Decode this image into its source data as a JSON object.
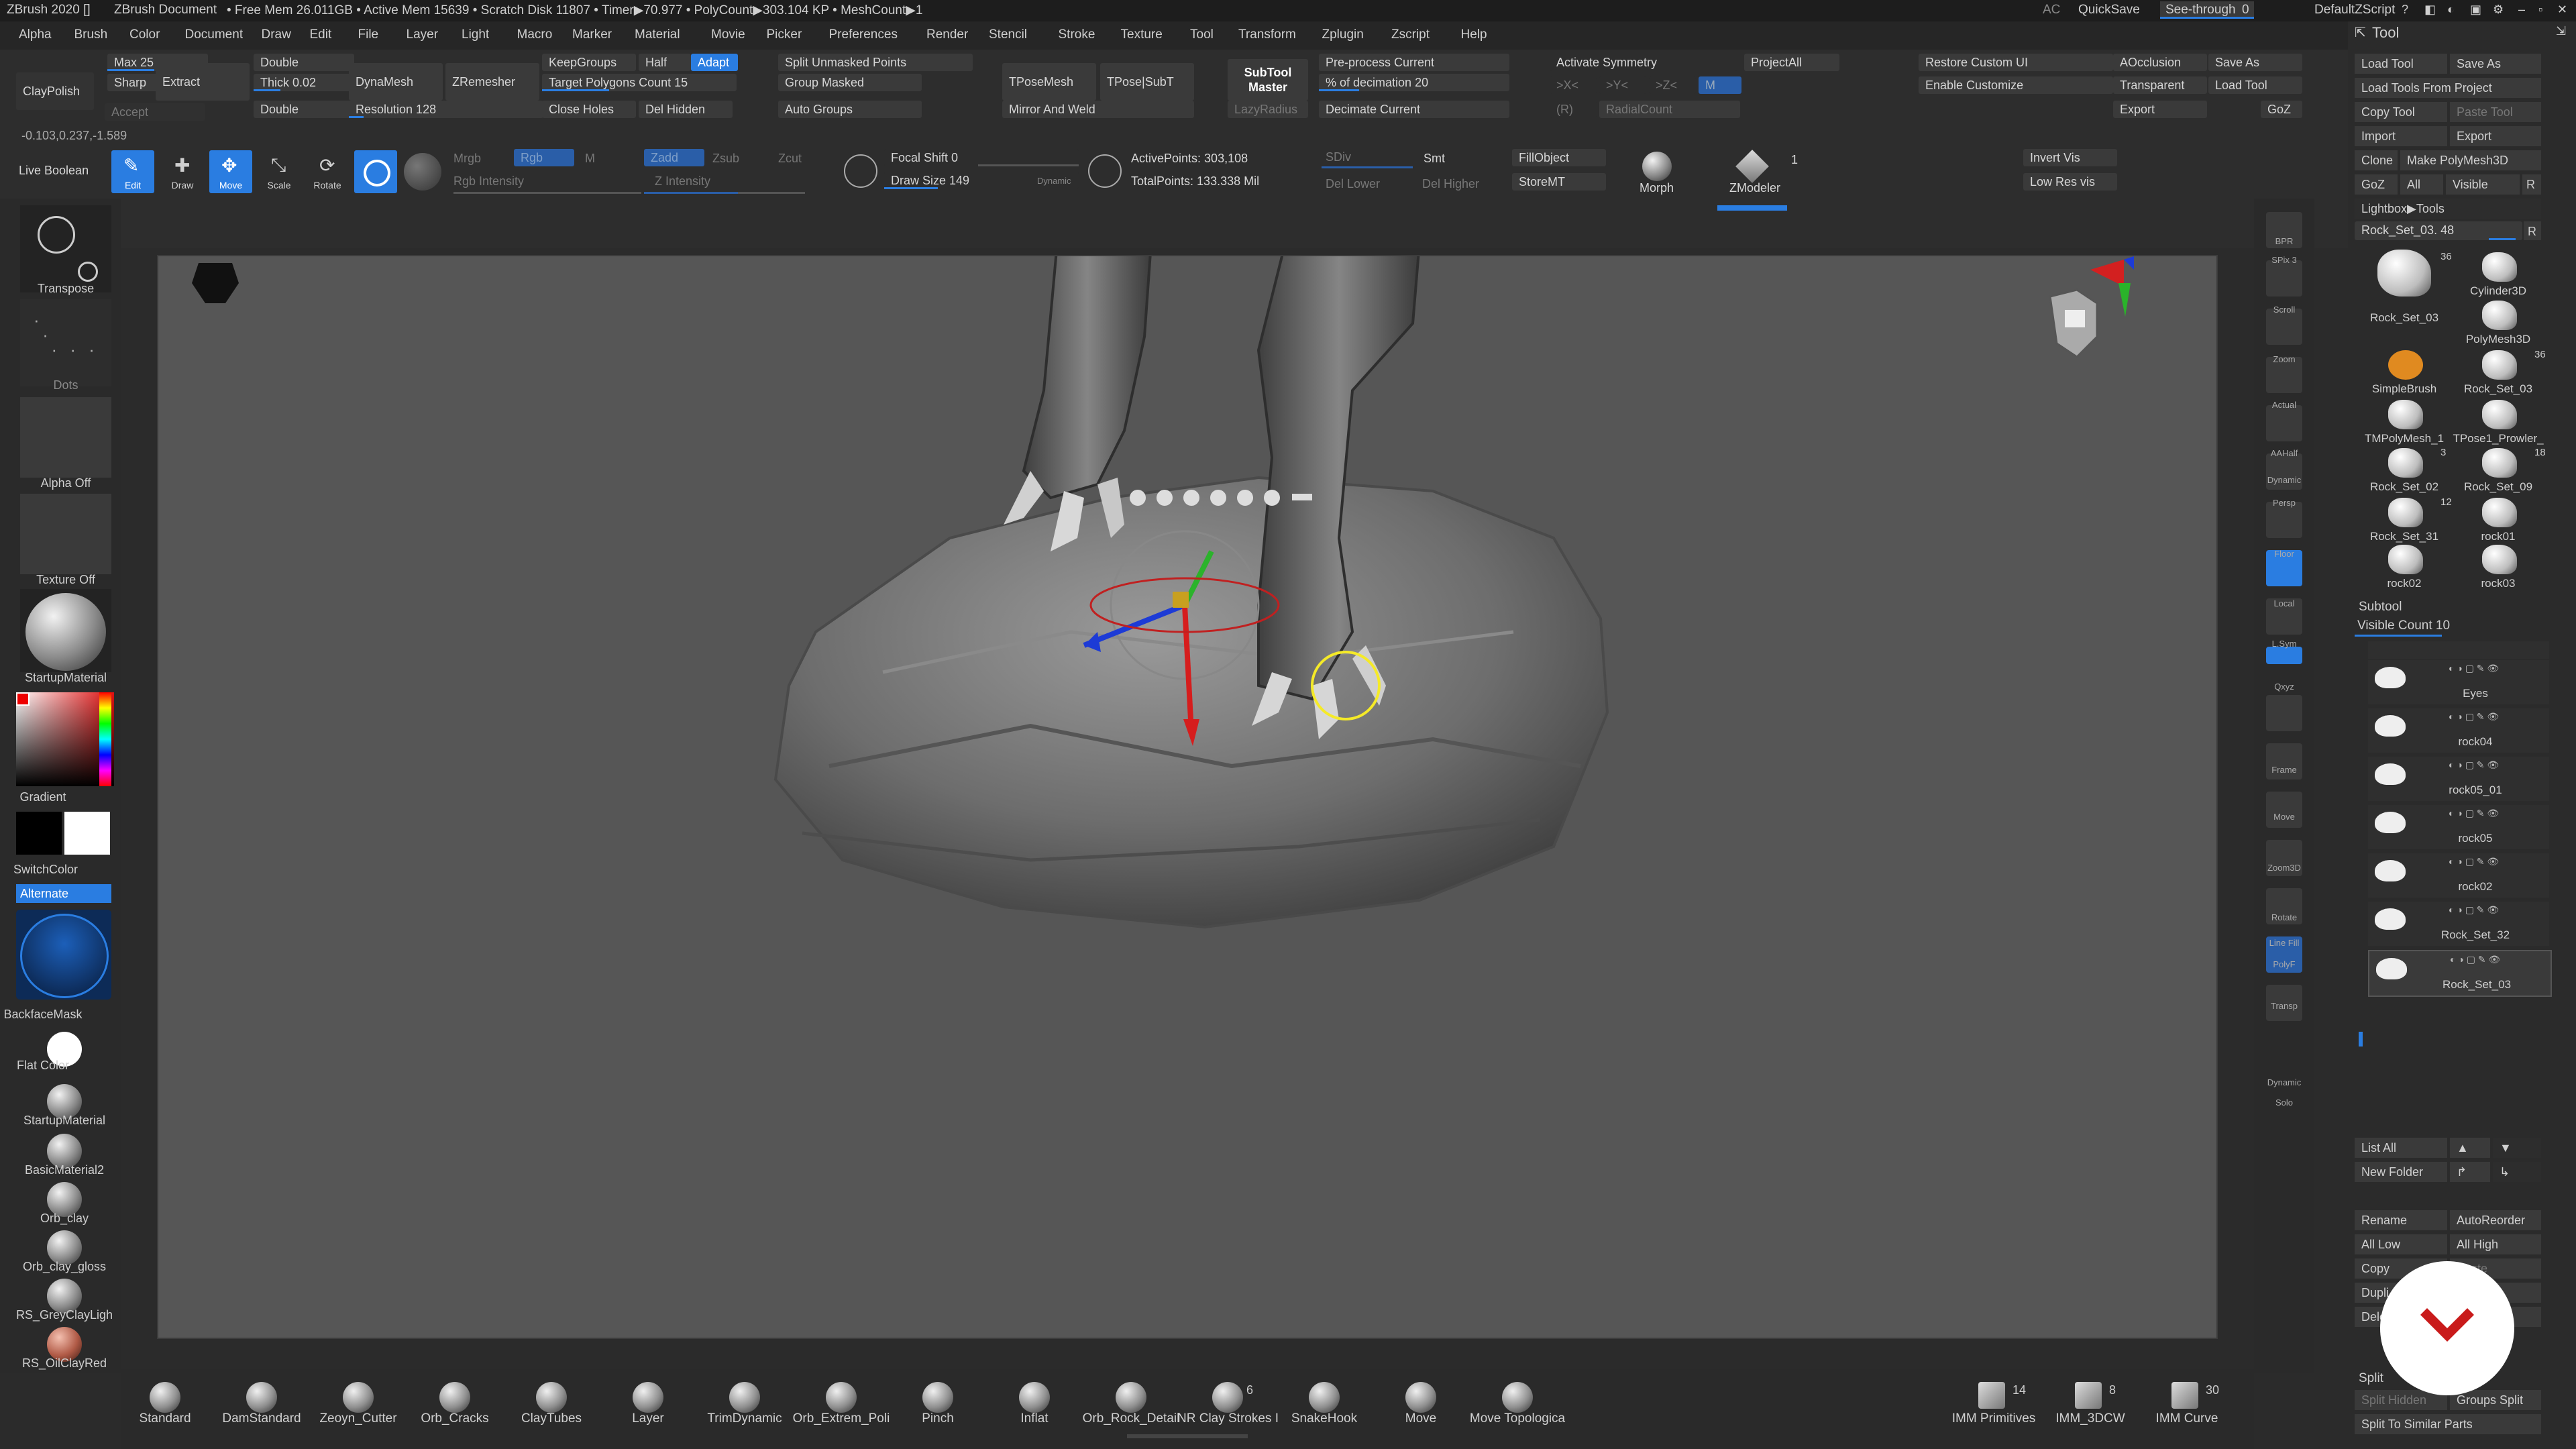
{
  "title": {
    "app": "ZBrush 2020 []",
    "doc": "ZBrush Document",
    "stats": "• Free Mem 26.011GB • Active Mem 15639 • Scratch Disk 11807 • Timer▶70.977 • PolyCount▶303.104 KP • MeshCount▶1",
    "ac": "AC",
    "quicksave": "QuickSave",
    "see_through": "See-through",
    "see_through_val": "0",
    "script": "DefaultZScript"
  },
  "menu": [
    "Alpha",
    "Brush",
    "Color",
    "Document",
    "Draw",
    "Edit",
    "File",
    "Layer",
    "Light",
    "Macro",
    "Marker",
    "Material",
    "Movie",
    "Picker",
    "Preferences",
    "Render",
    "Stencil",
    "Stroke",
    "Texture",
    "Tool",
    "Transform",
    "Zplugin",
    "Zscript",
    "Help"
  ],
  "toolbar": {
    "claypolish": "ClayPolish",
    "accept": "Accept",
    "max": "Max 25",
    "sharp": "Sharp",
    "extract": "Extract",
    "double1": "Double",
    "thick": "Thick 0.02",
    "double2": "Double",
    "dynamesh": "DynaMesh",
    "resolution": "Resolution 128",
    "zremesher": "ZRemesher",
    "keepgroups": "KeepGroups",
    "half": "Half",
    "adapt": "Adapt",
    "target_polygons": "Target Polygons Count 15",
    "close_holes": "Close Holes",
    "del_hidden": "Del Hidden",
    "split_unmasked": "Split Unmasked Points",
    "group_masked": "Group Masked",
    "auto_groups": "Auto Groups",
    "tposemesh": "TPoseMesh",
    "tpose_subt": "TPose|SubT",
    "mirror_weld": "Mirror And Weld",
    "subtool_master_1": "SubTool",
    "subtool_master_2": "Master",
    "lazyradius": "LazyRadius",
    "preprocess": "Pre-process Current",
    "decimation": "% of decimation 20",
    "decimate_current": "Decimate Current",
    "activate_symmetry": "Activate Symmetry",
    "sym_x": ">X<",
    "sym_y": ">Y<",
    "sym_z": ">Z<",
    "sym_m": "M",
    "sym_r": "(R)",
    "radialcount": "RadialCount",
    "projectall": "ProjectAll",
    "restore_ui": "Restore Custom UI",
    "enable_customize": "Enable Customize",
    "aocclusion": "AOcclusion",
    "transparent": "Transparent",
    "export": "Export",
    "save_as": "Save As",
    "load_tool": "Load Tool",
    "goz": "GoZ",
    "coords": "-0.103,0.237,-1.589",
    "live_boolean": "Live Boolean",
    "edit": "Edit",
    "draw": "Draw",
    "move": "Move",
    "scale": "Scale",
    "rotate": "Rotate",
    "mrgb": "Mrgb",
    "rgb": "Rgb",
    "m": "M",
    "rgb_intensity": "Rgb Intensity",
    "zadd": "Zadd",
    "zsub": "Zsub",
    "zcut": "Zcut",
    "z_intensity": "Z Intensity",
    "focal_shift": "Focal Shift 0",
    "draw_size": "Draw Size 149",
    "dynamic": "Dynamic",
    "active_points": "ActivePoints: 303,108",
    "total_points": "TotalPoints: 133.338 Mil",
    "sdiv": "SDiv",
    "smt": "Smt",
    "del_lower": "Del Lower",
    "del_higher": "Del Higher",
    "fillobject": "FillObject",
    "storemt": "StoreMT",
    "morph": "Morph",
    "zmodeler": "ZModeler",
    "zmodeler_count": "1",
    "invert_vis": "Invert Vis",
    "low_res_vis": "Low Res vis"
  },
  "left": {
    "transpose": "Transpose",
    "dots": "Dots",
    "alpha_off": "Alpha Off",
    "texture_off": "Texture Off",
    "startup_material": "StartupMaterial",
    "gradient": "Gradient",
    "switchcolor": "SwitchColor",
    "alternate": "Alternate",
    "backfacemask": "BackfaceMask",
    "flat_color": "Flat Color",
    "materials": [
      "StartupMaterial",
      "BasicMaterial2",
      "Orb_clay",
      "Orb_clay_gloss",
      "RS_GreyClayLigh",
      "RS_OilClayRed"
    ],
    "colors": {
      "accent": "#2a7de1",
      "main_color": "#ffffff",
      "secondary_color": "#000000"
    }
  },
  "right_shelf": [
    "BPR",
    "SPix 3",
    "Scroll",
    "Zoom",
    "Actual",
    "AAHalf",
    "Dynamic",
    "Persp",
    "Floor",
    "Local",
    "L.Sym",
    "Qxyz",
    "Frame",
    "Move",
    "Zoom3D",
    "Rotate",
    "Line Fill",
    "PolyF",
    "Transp",
    "Dynamic",
    "Solo"
  ],
  "tool": {
    "header": "Tool",
    "load_tool": "Load Tool",
    "save_as": "Save As",
    "load_from_project": "Load Tools From Project",
    "copy_tool": "Copy Tool",
    "paste_tool": "Paste Tool",
    "import": "Import",
    "export": "Export",
    "clone": "Clone",
    "make_polymesh": "Make PolyMesh3D",
    "goz": "GoZ",
    "all": "All",
    "visible": "Visible",
    "r": "R",
    "lightbox_tools": "Lightbox▶Tools",
    "current_tool": "Rock_Set_03. 48",
    "thumbs": [
      {
        "label": "Rock_Set_03",
        "count": "36"
      },
      {
        "label": "Cylinder3D",
        "count": ""
      },
      {
        "label": "PolyMesh3D",
        "count": ""
      },
      {
        "label": "SimpleBrush",
        "count": ""
      },
      {
        "label": "Rock_Set_03",
        "count": "36"
      },
      {
        "label": "TMPolyMesh_1",
        "count": ""
      },
      {
        "label": "TPose1_Prowler_",
        "count": ""
      },
      {
        "label": "Rock_Set_02",
        "count": "3"
      },
      {
        "label": "Rock_Set_09",
        "count": "18"
      },
      {
        "label": "Rock_Set_31",
        "count": "12"
      },
      {
        "label": "rock01",
        "count": ""
      },
      {
        "label": "rock02",
        "count": ""
      },
      {
        "label": "rock03",
        "count": ""
      }
    ],
    "subtool_header": "Subtool",
    "visible_count": "Visible Count 10",
    "subtools": [
      "Eyes",
      "rock04",
      "rock05_01",
      "rock05",
      "rock02",
      "Rock_Set_32",
      "Rock_Set_03"
    ],
    "list_all": "List All",
    "new_folder": "New Folder",
    "rename": "Rename",
    "autoreorder": "AutoReorder",
    "all_low": "All Low",
    "all_high": "All High",
    "copy": "Copy",
    "paste": "Paste",
    "duplicate": "Dupli",
    "delete": "Dele",
    "split": "Split",
    "split_hidden": "Split Hidden",
    "groups_split": "Groups Split",
    "split_similar": "Split To Similar Parts"
  },
  "brushes": [
    {
      "label": "Standard",
      "count": ""
    },
    {
      "label": "DamStandard",
      "count": ""
    },
    {
      "label": "Zeoyn_Cutter",
      "count": ""
    },
    {
      "label": "Orb_Cracks",
      "count": ""
    },
    {
      "label": "ClayTubes",
      "count": ""
    },
    {
      "label": "Layer",
      "count": ""
    },
    {
      "label": "TrimDynamic",
      "count": ""
    },
    {
      "label": "Orb_Extrem_Poli",
      "count": ""
    },
    {
      "label": "Pinch",
      "count": ""
    },
    {
      "label": "Inflat",
      "count": ""
    },
    {
      "label": "Orb_Rock_Detail",
      "count": ""
    },
    {
      "label": "NR Clay Strokes I",
      "count": "6"
    },
    {
      "label": "SnakeHook",
      "count": ""
    },
    {
      "label": "Move",
      "count": ""
    },
    {
      "label": "Move Topologica",
      "count": ""
    },
    {
      "label": "IMM Primitives",
      "count": "14"
    },
    {
      "label": "IMM_3DCW",
      "count": "8"
    },
    {
      "label": "IMM Curve",
      "count": "30"
    }
  ]
}
